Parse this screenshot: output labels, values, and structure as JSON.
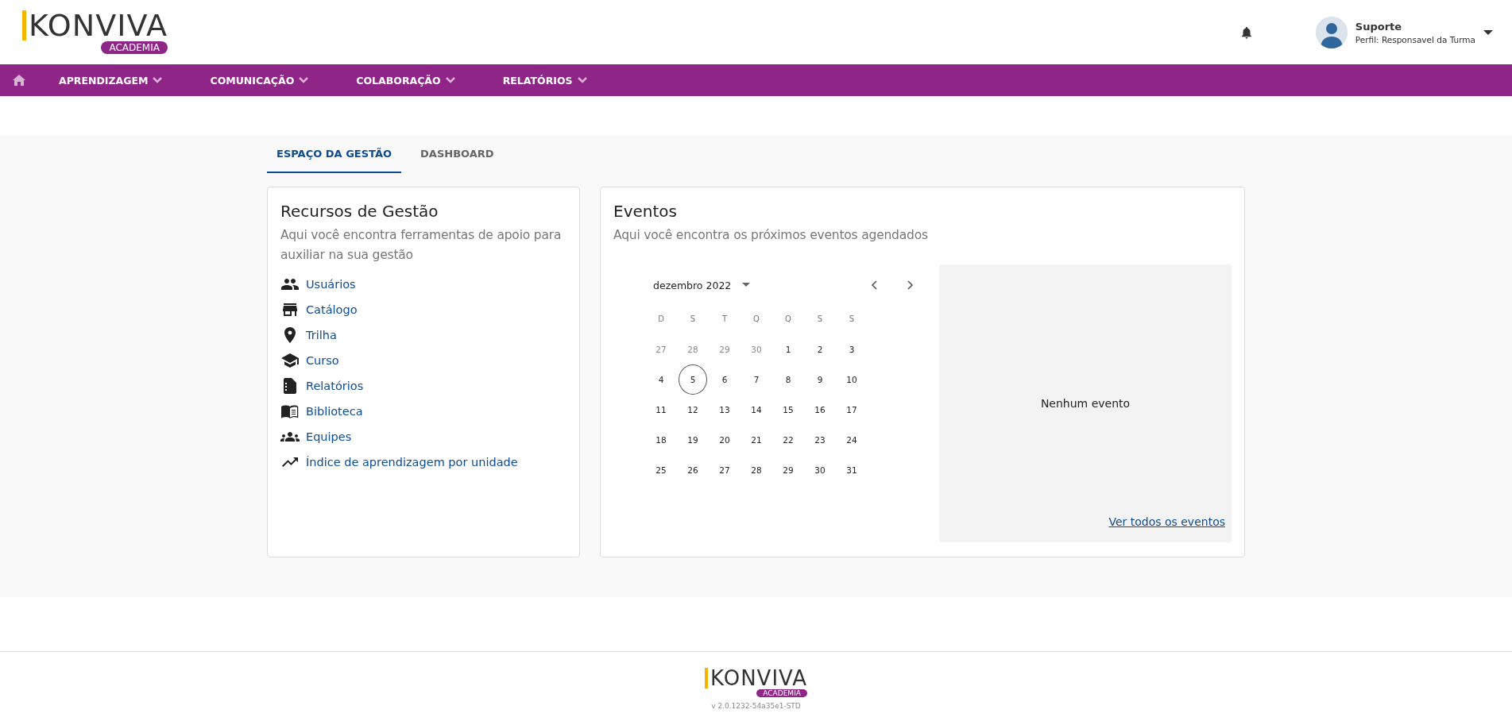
{
  "header": {
    "logo": {
      "wordmark": "KONVIVA",
      "badge": "ACADEMIA"
    },
    "user": {
      "name": "Suporte",
      "profile": "Perfil: Responsavel da Turma"
    }
  },
  "nav": {
    "items": [
      {
        "label": "APRENDIZAGEM"
      },
      {
        "label": "COMUNICAÇÃO"
      },
      {
        "label": "COLABORAÇÃO"
      },
      {
        "label": "RELATÓRIOS"
      }
    ]
  },
  "tabs": [
    {
      "label": "ESPAÇO DA GESTÃO",
      "selected": true
    },
    {
      "label": "DASHBOARD",
      "selected": false
    }
  ],
  "resources": {
    "title": "Recursos de Gestão",
    "subtitle": "Aqui você encontra ferramentas de apoio para auxiliar na sua gestão",
    "links": [
      {
        "kind": "users",
        "label": "Usuários"
      },
      {
        "kind": "store",
        "label": "Catálogo"
      },
      {
        "kind": "pin",
        "label": "Trilha"
      },
      {
        "kind": "school",
        "label": "Curso"
      },
      {
        "kind": "report",
        "label": "Relatórios"
      },
      {
        "kind": "book",
        "label": "Biblioteca"
      },
      {
        "kind": "groups",
        "label": "Equipes"
      },
      {
        "kind": "trend",
        "label": "Índice de aprendizagem por unidade"
      }
    ]
  },
  "events": {
    "title": "Eventos",
    "subtitle": "Aqui você encontra os próximos eventos agendados",
    "calendar": {
      "month": "dezembro 2022",
      "weekdays": [
        "D",
        "S",
        "T",
        "Q",
        "Q",
        "S",
        "S"
      ],
      "days": [
        {
          "label": "27",
          "muted": true,
          "selected": false
        },
        {
          "label": "28",
          "muted": true,
          "selected": false
        },
        {
          "label": "29",
          "muted": true,
          "selected": false
        },
        {
          "label": "30",
          "muted": true,
          "selected": false
        },
        {
          "label": "1",
          "muted": false,
          "selected": false
        },
        {
          "label": "2",
          "muted": false,
          "selected": false
        },
        {
          "label": "3",
          "muted": false,
          "selected": false
        },
        {
          "label": "4",
          "muted": false,
          "selected": false
        },
        {
          "label": "5",
          "muted": false,
          "selected": true
        },
        {
          "label": "6",
          "muted": false,
          "selected": false
        },
        {
          "label": "7",
          "muted": false,
          "selected": false
        },
        {
          "label": "8",
          "muted": false,
          "selected": false
        },
        {
          "label": "9",
          "muted": false,
          "selected": false
        },
        {
          "label": "10",
          "muted": false,
          "selected": false
        },
        {
          "label": "11",
          "muted": false,
          "selected": false
        },
        {
          "label": "12",
          "muted": false,
          "selected": false
        },
        {
          "label": "13",
          "muted": false,
          "selected": false
        },
        {
          "label": "14",
          "muted": false,
          "selected": false
        },
        {
          "label": "15",
          "muted": false,
          "selected": false
        },
        {
          "label": "16",
          "muted": false,
          "selected": false
        },
        {
          "label": "17",
          "muted": false,
          "selected": false
        },
        {
          "label": "18",
          "muted": false,
          "selected": false
        },
        {
          "label": "19",
          "muted": false,
          "selected": false
        },
        {
          "label": "20",
          "muted": false,
          "selected": false
        },
        {
          "label": "21",
          "muted": false,
          "selected": false
        },
        {
          "label": "22",
          "muted": false,
          "selected": false
        },
        {
          "label": "23",
          "muted": false,
          "selected": false
        },
        {
          "label": "24",
          "muted": false,
          "selected": false
        },
        {
          "label": "25",
          "muted": false,
          "selected": false
        },
        {
          "label": "26",
          "muted": false,
          "selected": false
        },
        {
          "label": "27",
          "muted": false,
          "selected": false
        },
        {
          "label": "28",
          "muted": false,
          "selected": false
        },
        {
          "label": "29",
          "muted": false,
          "selected": false
        },
        {
          "label": "30",
          "muted": false,
          "selected": false
        },
        {
          "label": "31",
          "muted": false,
          "selected": false
        }
      ]
    },
    "empty_message": "Nenhum evento",
    "all_link": "Ver todos os eventos"
  },
  "footer": {
    "logo": {
      "wordmark": "KONVIVA",
      "badge": "ACADEMIA"
    },
    "version": "v 2.0.1232-54a35e1-STD"
  }
}
